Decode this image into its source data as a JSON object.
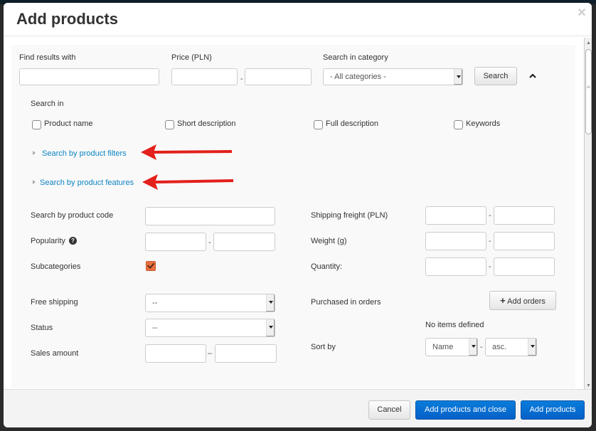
{
  "modal": {
    "title": "Add products",
    "close_icon": "close-icon"
  },
  "search": {
    "find_label": "Find results with",
    "find_value": "",
    "price_label": "Price (PLN)",
    "price_from": "",
    "price_to": "",
    "range_sep": "-",
    "category_label": "Search in category",
    "category_selected": "- All categories -",
    "search_button": "Search",
    "collapse_icon": "chevron-up-icon"
  },
  "search_in": {
    "label": "Search in",
    "options": [
      {
        "label": "Product name",
        "checked": false
      },
      {
        "label": "Short description",
        "checked": false
      },
      {
        "label": "Full description",
        "checked": false
      },
      {
        "label": "Keywords",
        "checked": false
      }
    ]
  },
  "expanders": [
    {
      "label": "Search by product filters",
      "annotated": true
    },
    {
      "label": "Search by product features",
      "annotated": true
    }
  ],
  "annotations": {
    "arrow_color": "#e3201b"
  },
  "left_fields": {
    "product_code_label": "Search by product code",
    "popularity_label": "Popularity",
    "popularity_help_icon": "question-circle-icon",
    "subcategories_label": "Subcategories",
    "subcategories_checked": true,
    "free_shipping_label": "Free shipping",
    "free_shipping_value": "--",
    "status_label": "Status",
    "status_value": "--",
    "sales_amount_label": "Sales amount",
    "sales_sep": "–"
  },
  "right_fields": {
    "shipping_freight_label": "Shipping freight (PLN)",
    "weight_label": "Weight (g)",
    "quantity_label": "Quantity:",
    "purchased_label": "Purchased in orders",
    "add_orders_button": "Add orders",
    "no_items": "No items defined",
    "sort_by_label": "Sort by",
    "sort_field": "Name",
    "sort_order": "asc."
  },
  "footer": {
    "cancel": "Cancel",
    "add_and_close": "Add products and close",
    "add": "Add products"
  }
}
